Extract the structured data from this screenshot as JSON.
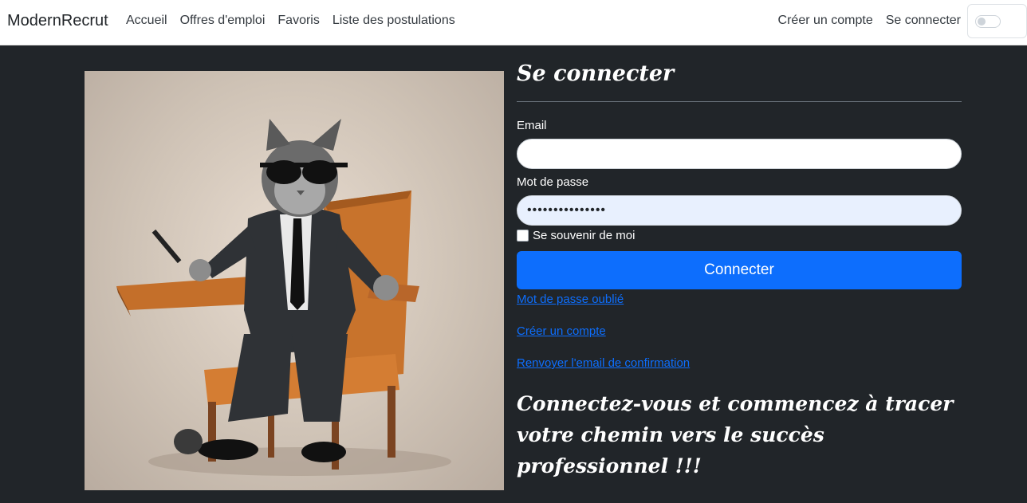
{
  "navbar": {
    "brand": "ModernRecrut",
    "left_links": [
      "Accueil",
      "Offres d'emploi",
      "Favoris",
      "Liste des postulations"
    ],
    "right_links": [
      "Créer un compte",
      "Se connecter"
    ]
  },
  "form": {
    "title": "Se connecter",
    "email_label": "Email",
    "email_value": "",
    "password_label": "Mot de passe",
    "password_value": "•••••••••••••••",
    "remember_label": "Se souvenir de moi",
    "submit_label": "Connecter",
    "links": [
      "Mot de passe oublié",
      "Créer un compte",
      "Renvoyer l'email de confirmation"
    ],
    "tagline": "Connectez-vous et commencez à tracer votre chemin vers le succès professionnel !!!"
  },
  "colors": {
    "page_bg": "#212529",
    "primary": "#0d6efd"
  }
}
